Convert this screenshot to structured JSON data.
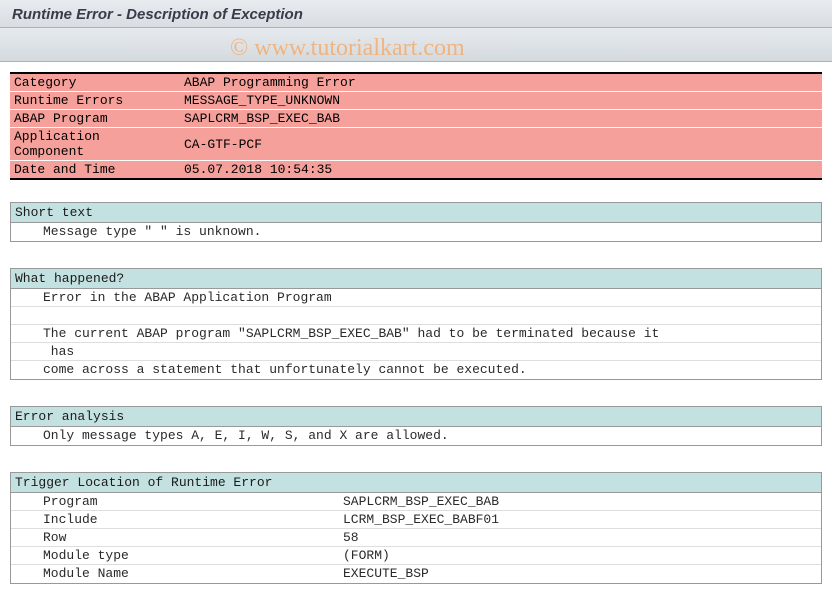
{
  "watermark": "© www.tutorialkart.com",
  "titlebar": {
    "title": "Runtime Error - Description of Exception"
  },
  "header": {
    "rows": [
      {
        "label": "Category",
        "value": "ABAP Programming Error"
      },
      {
        "label": "Runtime Errors",
        "value": "MESSAGE_TYPE_UNKNOWN"
      },
      {
        "label": "ABAP Program",
        "value": "SAPLCRM_BSP_EXEC_BAB"
      },
      {
        "label": "Application Component",
        "value": "CA-GTF-PCF"
      },
      {
        "label": "Date and Time",
        "value": "05.07.2018 10:54:35"
      }
    ]
  },
  "sections": {
    "short_text": {
      "title": "Short text",
      "lines": [
        "Message type \" \" is unknown."
      ]
    },
    "what_happened": {
      "title": "What happened?",
      "lines": [
        "Error in the ABAP Application Program",
        "",
        "The current ABAP program \"SAPLCRM_BSP_EXEC_BAB\" had to be terminated because it",
        " has",
        "come across a statement that unfortunately cannot be executed."
      ]
    },
    "error_analysis": {
      "title": "Error analysis",
      "lines": [
        "Only message types A, E, I, W, S, and X are allowed."
      ]
    },
    "trigger_location": {
      "title": "Trigger Location of Runtime Error",
      "rows": [
        {
          "key": "Program",
          "value": "SAPLCRM_BSP_EXEC_BAB"
        },
        {
          "key": "Include",
          "value": "LCRM_BSP_EXEC_BABF01"
        },
        {
          "key": "Row",
          "value": "58"
        },
        {
          "key": "Module type",
          "value": "(FORM)"
        },
        {
          "key": "Module Name",
          "value": "EXECUTE_BSP"
        }
      ]
    }
  }
}
